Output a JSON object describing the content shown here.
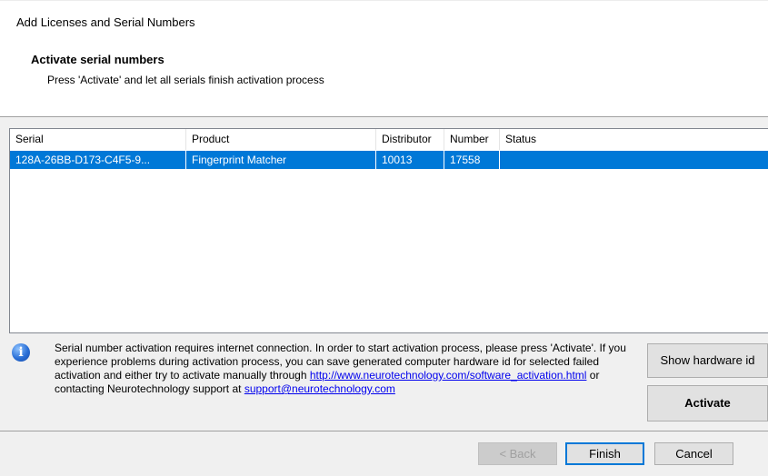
{
  "window": {
    "title": "Add Licenses and Serial Numbers"
  },
  "section": {
    "title": "Activate serial numbers",
    "subtitle": "Press 'Activate' and let all serials finish activation process"
  },
  "table": {
    "columns": [
      "Serial",
      "Product",
      "Distributor",
      "Number",
      "Status"
    ],
    "rows": [
      [
        "128A-26BB-D173-C4F5-9...",
        "Fingerprint Matcher",
        "10013",
        "17558",
        ""
      ]
    ],
    "selected_row_color": "#0078d7"
  },
  "info": {
    "icon": "info-icon",
    "text_1": "Serial number activation requires internet connection. In order to start activation process, please press 'Activate'.  If you experience problems during activation process, you can save generated computer hardware id for selected failed activation and either try to activate manually through",
    "link_url_text": "http://www.neurotechnology.com/software_activation.html",
    "text_2": " or contacting Neurotechnology support at ",
    "link_email_text": "support@neurotechnology.com"
  },
  "buttons": {
    "show_hardware_id": "Show hardware id",
    "activate": "Activate",
    "back": "< Back",
    "finish": "Finish",
    "cancel": "Cancel"
  },
  "colors": {
    "accent": "#0078d7",
    "link": "#0000ee"
  }
}
